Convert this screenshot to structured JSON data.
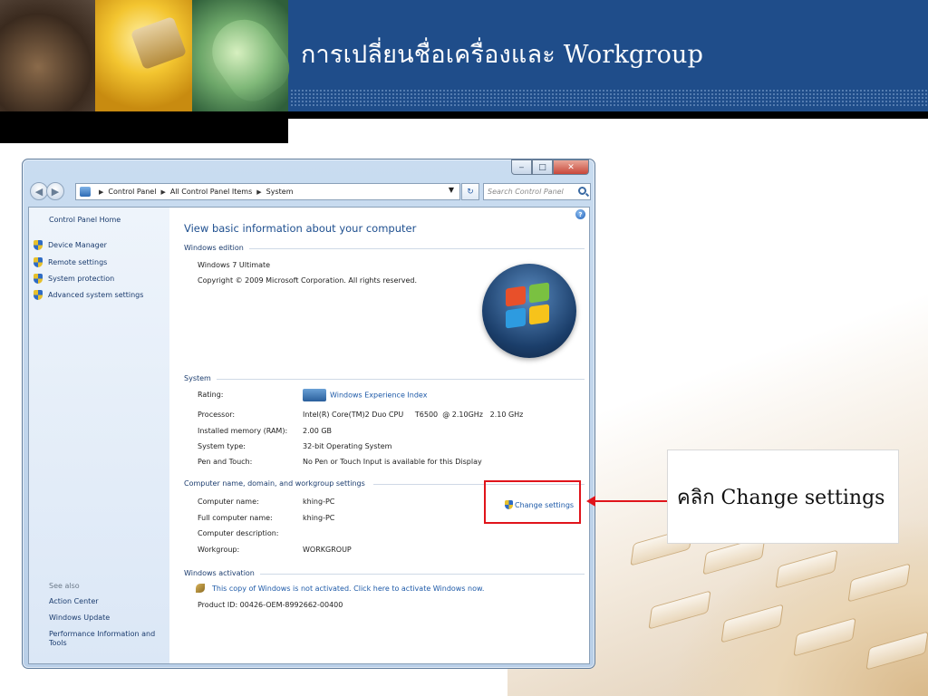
{
  "slide": {
    "title": "การเปลี่ยนชื่อเครื่องและ Workgroup",
    "callout_text": "คลิก Change settings"
  },
  "window": {
    "caption_buttons": {
      "minimize": "‒",
      "maximize": "□",
      "close": "✕"
    },
    "breadcrumb": [
      "Control Panel",
      "All Control Panel Items",
      "System"
    ],
    "search_placeholder": "Search Control Panel",
    "sidebar": {
      "home": "Control Panel Home",
      "tasks": [
        "Device Manager",
        "Remote settings",
        "System protection",
        "Advanced system settings"
      ],
      "see_also_label": "See also",
      "see_also": [
        "Action Center",
        "Windows Update",
        "Performance Information and Tools"
      ]
    },
    "main": {
      "title": "View basic information about your computer",
      "edition_section": "Windows edition",
      "edition_name": "Windows 7 Ultimate",
      "copyright": "Copyright © 2009 Microsoft Corporation.  All rights reserved.",
      "system_section": "System",
      "system_rows": [
        {
          "label": "Rating:",
          "value": "Windows Experience Index"
        },
        {
          "label": "Processor:",
          "value": "Intel(R) Core(TM)2 Duo CPU     T6500  @ 2.10GHz   2.10 GHz"
        },
        {
          "label": "Installed memory (RAM):",
          "value": "2.00 GB"
        },
        {
          "label": "System type:",
          "value": "32-bit Operating System"
        },
        {
          "label": "Pen and Touch:",
          "value": "No Pen or Touch Input is available for this Display"
        }
      ],
      "computer_section": "Computer name, domain, and workgroup settings",
      "computer_rows": [
        {
          "label": "Computer name:",
          "value": "khing-PC"
        },
        {
          "label": "Full computer name:",
          "value": "khing-PC"
        },
        {
          "label": "Computer description:",
          "value": ""
        },
        {
          "label": "Workgroup:",
          "value": "WORKGROUP"
        }
      ],
      "change_settings": "Change settings",
      "activation_section": "Windows activation",
      "activation_message": "This copy of Windows is not activated. Click here to activate Windows now.",
      "product_id": "Product ID: 00426-OEM-8992662-00400"
    }
  },
  "colors": {
    "header": "#1f4d8a",
    "highlight": "#e0141b",
    "link": "#1e5aa8"
  }
}
